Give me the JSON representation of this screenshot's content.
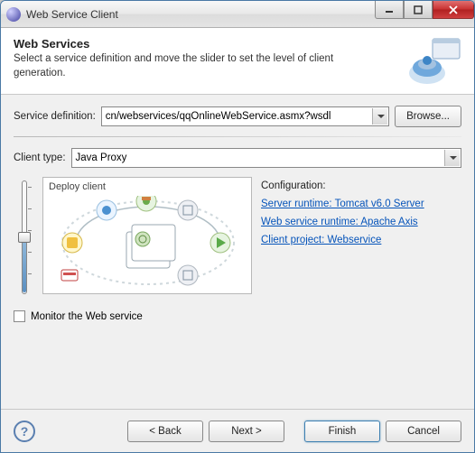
{
  "window": {
    "title": "Web Service Client"
  },
  "header": {
    "heading": "Web Services",
    "description": "Select a service definition and move the slider to set the level of client generation."
  },
  "service_def": {
    "label": "Service definition:",
    "value": "cn/webservices/qqOnlineWebService.asmx?wsdl",
    "browse": "Browse..."
  },
  "client_type": {
    "label": "Client type:",
    "value": "Java Proxy"
  },
  "diagram": {
    "caption": "Deploy client"
  },
  "config": {
    "title": "Configuration:",
    "links": [
      "Server runtime: Tomcat v6.0 Server",
      "Web service runtime: Apache Axis",
      "Client project: Webservice"
    ]
  },
  "monitor": {
    "label": "Monitor the Web service",
    "checked": false
  },
  "footer": {
    "back": "< Back",
    "next": "Next >",
    "finish": "Finish",
    "cancel": "Cancel"
  }
}
